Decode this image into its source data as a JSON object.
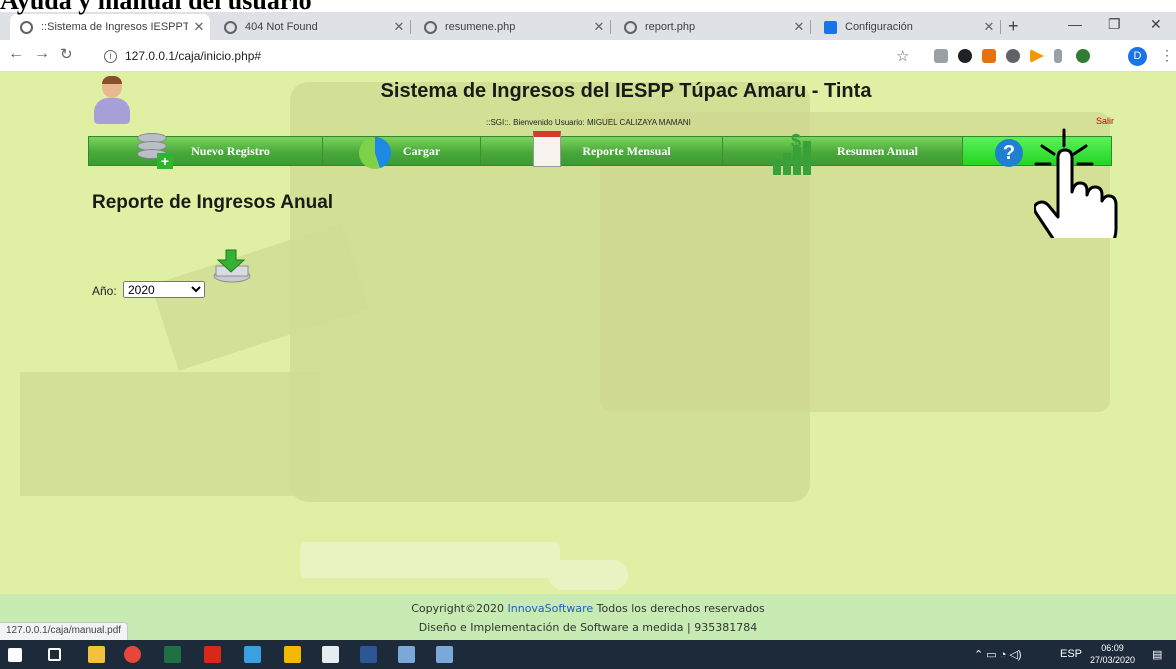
{
  "document_heading": "Ayuda y manual del usuario",
  "browser": {
    "tabs": [
      {
        "title": "::Sistema de Ingresos IESPPTA..",
        "icon": "globe-icon"
      },
      {
        "title": "404 Not Found",
        "icon": "globe-icon"
      },
      {
        "title": "resumene.php",
        "icon": "globe-icon"
      },
      {
        "title": "report.php",
        "icon": "globe-icon"
      },
      {
        "title": "Configuración",
        "icon": "gear-icon"
      }
    ],
    "url": "127.0.0.1/caja/inicio.php#",
    "profile_initial": "D",
    "status_url": "127.0.0.1/caja/manual.pdf"
  },
  "site": {
    "title": "Sistema de Ingresos del IESPP Túpac Amaru - Tinta",
    "welcome": "::SGI::. Bienvenido Usuario: MIGUEL CALIZAYA MAMANI",
    "logout": "Salir"
  },
  "nav": [
    {
      "label": "Nuevo Registro",
      "icon": "database-add-icon"
    },
    {
      "label": "Cargar",
      "icon": "sync-icon"
    },
    {
      "label": "Reporte Mensual",
      "icon": "calendar-icon"
    },
    {
      "label": "Resumen Anual",
      "icon": "bar-chart-dollar-icon"
    },
    {
      "label": "",
      "icon": "help-icon"
    }
  ],
  "report": {
    "title": "Reporte de Ingresos Anual",
    "year_label": "Año:",
    "year_value": "2020"
  },
  "footer": {
    "copyright_prefix": "Copyright©2020 ",
    "brand": "InnovaSoftware",
    "copyright_suffix": " Todos los derechos reservados",
    "line2": "Diseño e Implementación de Software a medida | 935381784"
  },
  "taskbar": {
    "language": "ESP",
    "time": "06:09",
    "date": "27/03/2020"
  },
  "colors": {
    "page_bg": "#dff0a4",
    "nav_green": "#49a93a",
    "nav_active": "#22d622",
    "footer_bg": "#c7ebb3",
    "logout_red": "#cc0000"
  }
}
